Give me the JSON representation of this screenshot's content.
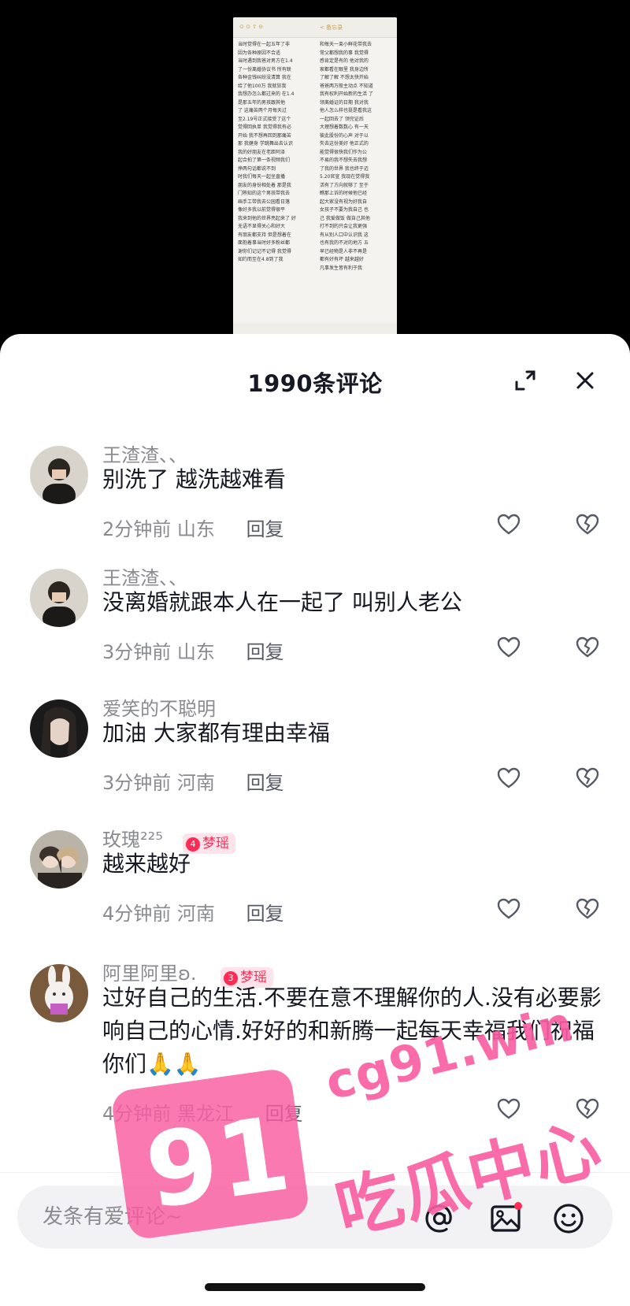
{
  "video": {
    "screenshot_toolbar_label": "< 备忘录",
    "note_lines_left": [
      "当时觉得在一起五年了非",
      "因为各种原因不合适",
      "当时遇到我爸对男方在1.4",
      "了一份离婚协议书 所有联",
      "各种金钱纠纷没清算 我在",
      "给了他100万 我就狂我",
      "我想办怎么都过来的 在1.4",
      "是那五年的男孩跟其他",
      "了 这痛苦两个月每天过",
      "至2.19号正式接受了这个",
      "觉得回执单 我觉得我有必",
      "开始 我不想再回到那痛苦",
      "那 我健身 学跳舞出去认识",
      "我的好朋友在老距阿泽",
      "起合拍了第一条视频我们",
      "挣两句话都说不到",
      "时我们每天一起坐直播",
      "朋友的身份相处着 那是我",
      "门熟知的这个男孩带我去",
      "画手工带我去公园看日落",
      "像好多我以前觉得很平",
      "我来到他的世界亮起来了 好",
      "无语不显得关心和好大",
      "有朋友都支持 但是想着在",
      "面抱着事当时好多粉丝都",
      "谢你们记记不记得 我觉得",
      "如约而至在4.8到了我"
    ],
    "note_lines_right": [
      "和每天一束小鲜花带我去",
      "常父都想我的事 我觉得",
      "感肯定是有的 他对我的",
      "家都看在眼里 我身边所",
      "了解了解 不想太快开始",
      "爸爸两万般主动点 不知道",
      "我有权利开始新的生活 了",
      "领离婚证的日期 我对我",
      "他人怎么样也挺是看我这",
      "一起回去了 领完证后",
      "大理想着数数心 有一天",
      "彼此股份的心声 对于以",
      "失去这份美好 他正式的",
      "能觉得很快我们作为公",
      "不易的我不想失去我想",
      "了我的世界 我也终于迈",
      "5.20官宣 我现在觉得我",
      "活有了方向就够了 至于",
      "瞧那上诉的时候他已经",
      "起大家没有视为好我自",
      "女孩子不要为我自己 也",
      "己 我爱做饭 做自己其他",
      "打不到的只会让我更强",
      "有从别人口中认识我 这",
      "也有我的不对的地方 五",
      "早已经物是人非不再是",
      "都有好有坏 越来越好",
      "凡事发生皆有利于我"
    ]
  },
  "header": {
    "title": "1990条评论"
  },
  "comments": [
    {
      "username": "王渣渣、、",
      "text": "别洗了 越洗越难看",
      "time": "2分钟前",
      "location": "山东",
      "reply": "回复"
    },
    {
      "username": "王渣渣、、",
      "text": "没离婚就跟本人在一起了 叫别人老公",
      "time": "3分钟前",
      "location": "山东",
      "reply": "回复"
    },
    {
      "username": "爱笑的不聪明",
      "text": "加油 大家都有理由幸福",
      "time": "3分钟前",
      "location": "河南",
      "reply": "回复"
    },
    {
      "username": "玫瑰²²⁵",
      "badge_level": "4",
      "badge_text": "梦瑶",
      "text": "越来越好",
      "time": "4分钟前",
      "location": "河南",
      "reply": "回复"
    },
    {
      "username": "阿里阿里ʚ.",
      "badge_level": "3",
      "badge_text": "梦瑶",
      "text": "过好自己的生活.不要在意不理解你的人.没有必要影响自己的心情.好好的和新腾一起每天幸福我们祝福你们🙏🙏",
      "time": "4分钟前",
      "location": "黑龙江",
      "reply": "回复"
    }
  ],
  "input": {
    "placeholder": "发条有爱评论~"
  },
  "watermark": {
    "number": "91",
    "url": "cg91.win",
    "text": "吃瓜中心"
  },
  "colors": {
    "accent": "#fe2c55",
    "watermark_pink": "#fa5ca0",
    "text_primary": "#161823",
    "text_secondary": "#8a8b91"
  }
}
